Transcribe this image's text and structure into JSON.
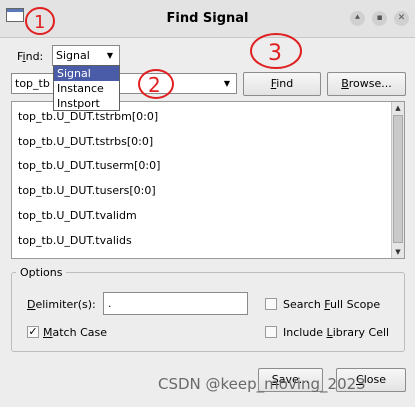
{
  "window": {
    "title": "Find Signal",
    "controls": [
      "⯅",
      "▪",
      "✕"
    ]
  },
  "find": {
    "label_prefix": "F",
    "label_underline": "i",
    "label_suffix": "nd:",
    "selected": "Signal",
    "options": [
      "Signal",
      "Instance",
      "Instport"
    ]
  },
  "scope": {
    "value": "top_tb"
  },
  "buttons": {
    "find": {
      "prefix": "",
      "underline": "F",
      "suffix": "ind"
    },
    "browse": {
      "prefix": "",
      "underline": "B",
      "suffix": "rowse..."
    },
    "save": {
      "prefix": "",
      "underline": "S",
      "suffix": "ave..."
    },
    "close": {
      "prefix": "",
      "underline": "C",
      "suffix": "lose"
    }
  },
  "signals": [
    "top_tb.U_DUT.tstrbm[0:0]",
    "top_tb.U_DUT.tstrbs[0:0]",
    "top_tb.U_DUT.tuserm[0:0]",
    "top_tb.U_DUT.tusers[0:0]",
    "top_tb.U_DUT.tvalidm",
    "top_tb.U_DUT.tvalids"
  ],
  "options": {
    "title": "Options",
    "delimiter": {
      "label_prefix": "",
      "label_underline": "D",
      "label_suffix": "elimiter(s):",
      "value": "."
    },
    "match_case": {
      "label_prefix": "",
      "label_underline": "M",
      "label_suffix": "atch Case",
      "checked": true
    },
    "search_full_scope": {
      "label_prefix": "Search ",
      "label_underline": "F",
      "label_suffix": "ull Scope",
      "checked": false
    },
    "include_library_cell": {
      "label_prefix": "Include ",
      "label_underline": "L",
      "label_suffix": "ibrary Cell",
      "checked": false
    }
  },
  "annotations": [
    "1",
    "2",
    "3"
  ],
  "watermark": "CSDN @keep_moving_2023",
  "colors": {
    "selection": "#4a5ca8",
    "annotation": "#e02020"
  }
}
